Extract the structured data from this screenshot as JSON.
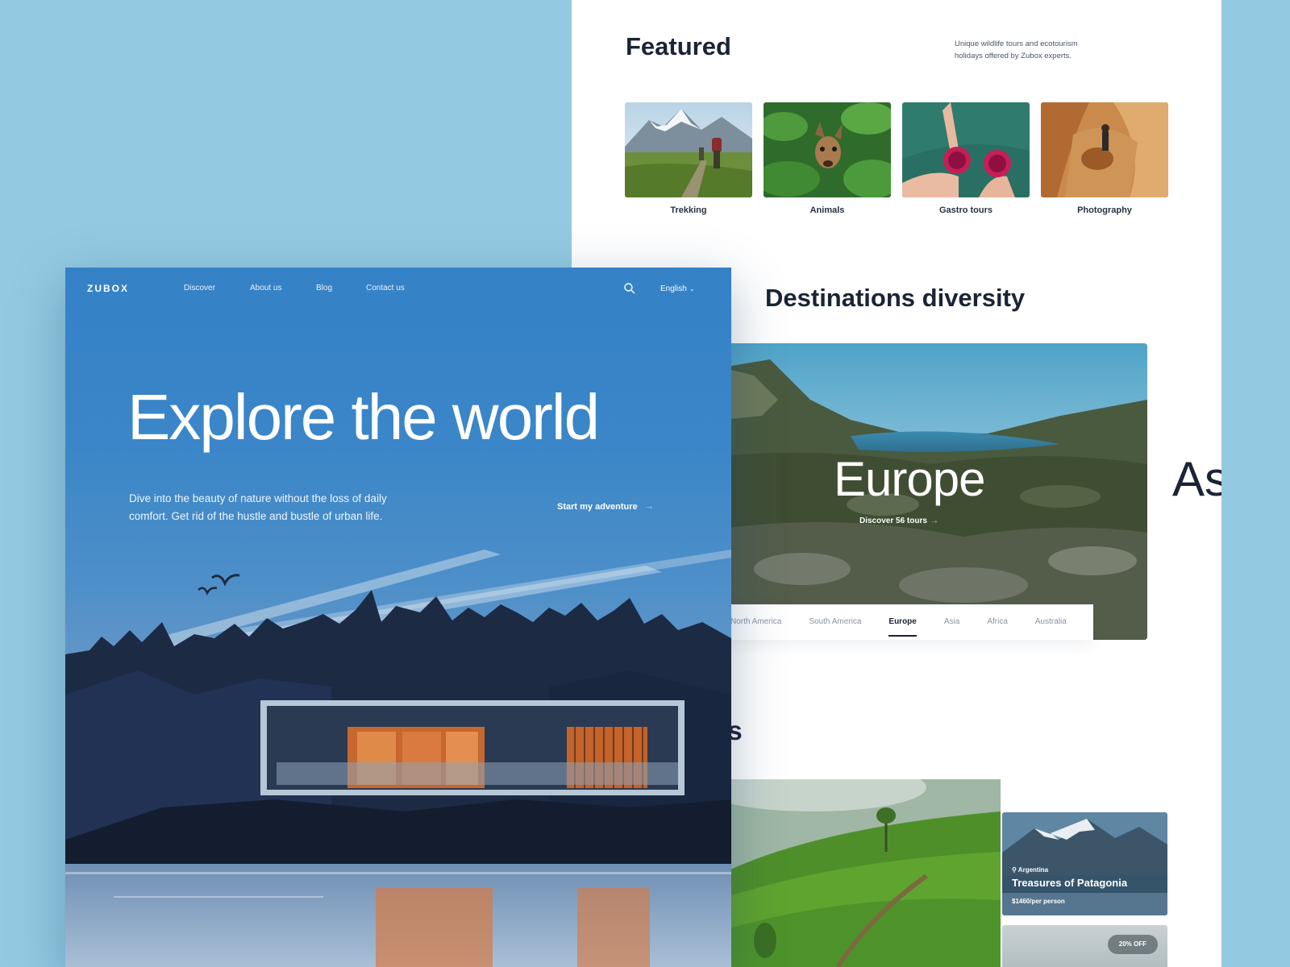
{
  "featured": {
    "title": "Featured",
    "description": "Unique wildlife tours and ecotourism holidays offered by Zubox experts.",
    "categories": [
      {
        "label": "Trekking"
      },
      {
        "label": "Animals"
      },
      {
        "label": "Gastro tours"
      },
      {
        "label": "Photography"
      }
    ]
  },
  "destinations": {
    "title": "Destinations diversity",
    "current": "Europe",
    "discover_label": "Discover 56 tours",
    "next_peek": "As",
    "tabs": [
      "North America",
      "South America",
      "Europe",
      "Asia",
      "Africa",
      "Australia"
    ],
    "active_tab": "Europe"
  },
  "offers": {
    "title": "offers",
    "card": {
      "location": "Argentina",
      "name": "Treasures of Patagonia",
      "price": "$1460/per person"
    },
    "badge": "20% OFF"
  },
  "hero": {
    "logo": "ZUBOX",
    "nav": [
      "Discover",
      "About us",
      "Blog",
      "Contact us"
    ],
    "language": "English",
    "title": "Explore the world",
    "text": "Dive into the beauty of nature without the loss of daily comfort. Get rid of the hustle and bustle of urban life.",
    "cta": "Start my adventure"
  },
  "colors": {
    "background": "#93cae1",
    "hero_blue": "#3581c6",
    "heading": "#1b2436",
    "accent": "#7fd3f2"
  }
}
